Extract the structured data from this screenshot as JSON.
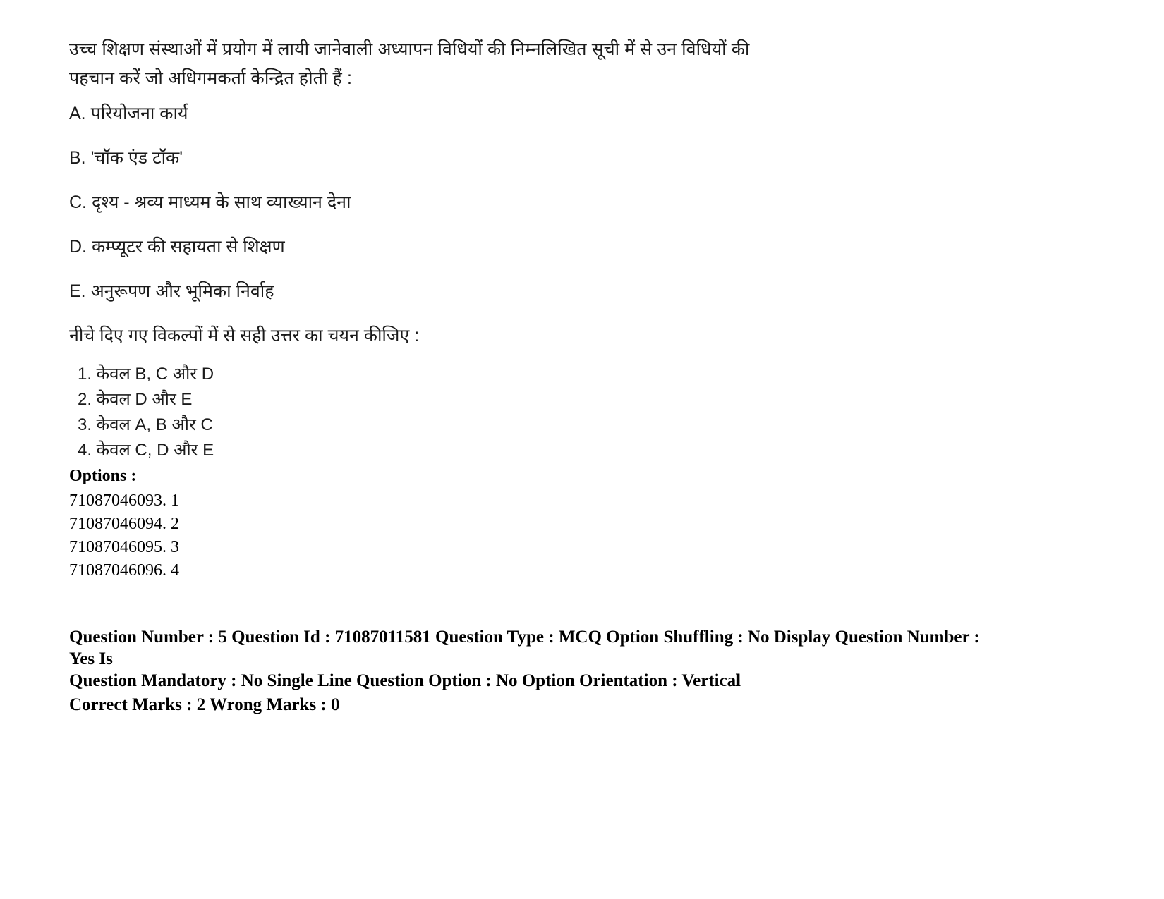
{
  "question": {
    "stem": "उच्च शिक्षण संस्थाओं में प्रयोग में लायी जानेवाली अध्यापन विधियों की निम्नलिखित सूची में से उन विधियों की पहचान करें जो अधिगमकर्ता केन्द्रित होती हैं :",
    "statements": [
      "A. परियोजना कार्य",
      "B. 'चॉक एंड टॉक'",
      "C. दृश्य - श्रव्य माध्यम के साथ व्याख्यान देना",
      "D. कम्प्यूटर की सहायता से शिक्षण",
      "E. अनुरूपण और भूमिका निर्वाह"
    ],
    "instruction": "नीचे दिए गए विकल्पों में से सही उत्तर का चयन कीजिए :",
    "choices": [
      "1. केवल B, C और D",
      "2. केवल D और E",
      "3. केवल A, B और C",
      "4. केवल C, D और E"
    ]
  },
  "options": {
    "heading": "Options :",
    "items": [
      "71087046093. 1",
      "71087046094. 2",
      "71087046095. 3",
      "71087046096. 4"
    ]
  },
  "meta": {
    "line1": "Question Number : 5 Question Id : 71087011581 Question Type : MCQ Option Shuffling : No Display Question Number : Yes Is",
    "line2": "Question Mandatory : No Single Line Question Option : No Option Orientation : Vertical",
    "line3": "Correct Marks : 2 Wrong Marks : 0"
  }
}
